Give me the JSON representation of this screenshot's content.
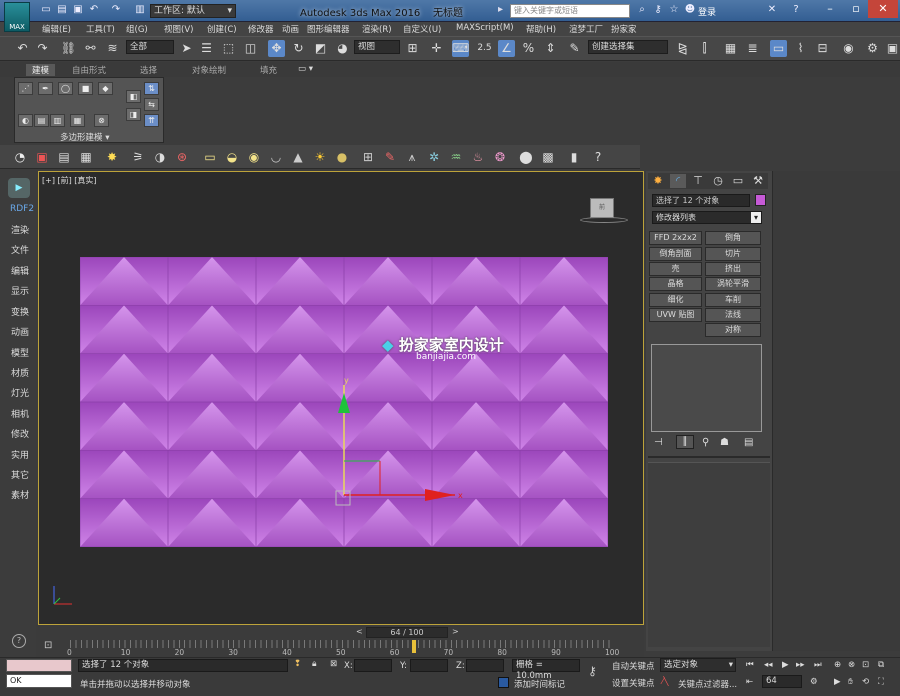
{
  "app": {
    "title": "Autodesk 3ds Max 2016",
    "doc_title": "无标题",
    "logo_label": "MAX"
  },
  "workspace": {
    "label": "工作区: 默认"
  },
  "search": {
    "placeholder": "键入关键字或短语"
  },
  "user": {
    "login_label": "登录"
  },
  "menus": [
    "编辑(E)",
    "工具(T)",
    "组(G)",
    "视图(V)",
    "创建(C)",
    "修改器",
    "动画",
    "图形编辑器",
    "渲染(R)",
    "自定义(U)",
    "MAXScript(M)",
    "帮助(H)",
    "渲梦工厂",
    "扮家家"
  ],
  "toolbar": {
    "selection_filter": "全部",
    "ref_coord": "视图",
    "named_selection": "创建选择集",
    "snap_label": "2.5"
  },
  "ribbon": {
    "tabs": [
      "建模",
      "自由形式",
      "选择",
      "对象绘制",
      "填充"
    ],
    "panel_label": "多边形建模"
  },
  "left_sidebar": [
    "RDF2",
    "渲染",
    "文件",
    "编辑",
    "显示",
    "变换",
    "动画",
    "模型",
    "材质",
    "灯光",
    "相机",
    "修改",
    "实用",
    "其它",
    "素材"
  ],
  "viewport": {
    "label": "[+] [前] [真实]",
    "watermark_title": "扮家家室内设计",
    "watermark_sub": "banjiajia.com",
    "axis_x": "x",
    "axis_y": "y",
    "wall_color": "#c26fdb"
  },
  "command_panel": {
    "object_name": "选择了 12 个对象",
    "modifier_list": "修改器列表",
    "modifier_buttons": [
      "FFD 2x2x2",
      "倒角",
      "倒角剖面",
      "切片",
      "壳",
      "挤出",
      "晶格",
      "涡轮平滑",
      "细化",
      "车削",
      "UVW 贴图",
      "法线",
      "对称"
    ],
    "color_swatch": "#c65ad6"
  },
  "timeline": {
    "frame_display": "64 / 100",
    "ticks": [
      "0",
      "10",
      "20",
      "30",
      "40",
      "50",
      "60",
      "70",
      "80",
      "90",
      "100"
    ],
    "current_frame": 64,
    "total_frames": 100
  },
  "status": {
    "selection_text": "选择了 12 个对象",
    "prompt_text": "单击并拖动以选择并移动对象",
    "maxscript_text": "OK",
    "x_label": "X:",
    "y_label": "Y:",
    "z_label": "Z:",
    "grid_text": "栅格 = 10.0mm",
    "add_time_tag": "添加时间标记",
    "auto_key": "自动关键点",
    "set_key": "设置关键点",
    "key_mode": "选定对象",
    "key_filters": "关键点过滤器...",
    "frame_field": "64"
  }
}
